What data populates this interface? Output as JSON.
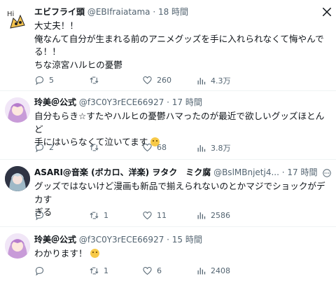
{
  "tweets": [
    {
      "name": "エビフライ頭",
      "handle": "@EBIfraiatama",
      "time": "18 時間",
      "lines": [
        "大丈夫！！",
        "俺なんて自分が生まれる前のアニメグッズを手に入れられなくて悔やんでる！！",
        "ちな涼宮ハルヒの憂鬱"
      ],
      "replies": "5",
      "retweets": "",
      "likes": "260",
      "views": "4.3万"
    },
    {
      "name": "玲美＠公式",
      "handle": "@f3C0Y3rECE66927",
      "time": "17 時間",
      "lines": [
        "自分もらき☆すたやハルヒの憂鬱ハマったのが最近で欲しいグッズほとんど",
        "手にはいらなくて泣いてます"
      ],
      "replies": "2",
      "retweets": "",
      "likes": "68",
      "views": "3.8万"
    },
    {
      "name": "ASARI@音楽 (ボカロ、洋楽) ヲタク　ミク腐",
      "handle": "@BslMBnjetj4...",
      "time": "17 時間",
      "lines": [
        "グッズではないけど漫画も新品で揃えられないのとかマジでショックがデカす",
        "ぎる"
      ],
      "replies": "",
      "retweets": "1",
      "likes": "11",
      "views": "2586"
    },
    {
      "name": "玲美＠公式",
      "handle": "@f3C0Y3rECE66927",
      "time": "15 時間",
      "lines": [
        "わかります！"
      ],
      "replies": "",
      "retweets": "1",
      "likes": "6",
      "views": "2408"
    }
  ],
  "icons": {
    "reply": "reply-icon",
    "retweet": "retweet-icon",
    "like": "heart-icon",
    "views": "views-chart-icon",
    "close": "x-logo-icon",
    "emoji": "crying-face-emoji-icon"
  },
  "colors": {
    "text": "#0f1419",
    "muted": "#536471",
    "divider": "#eff3f4",
    "thread": "#cfd9de"
  }
}
